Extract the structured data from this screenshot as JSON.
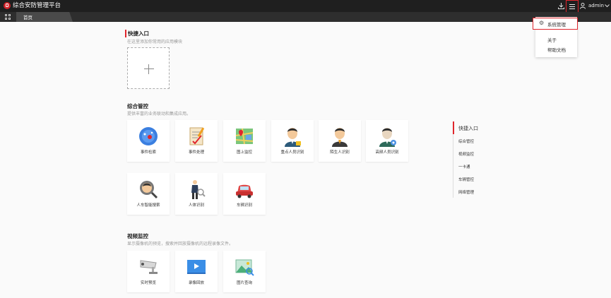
{
  "header": {
    "app_title": "综合安防管理平台",
    "username": "admin",
    "icons": [
      "download-icon",
      "menu-icon",
      "user-icon",
      "chevron-down-icon"
    ]
  },
  "tabs": [
    {
      "label": "首页",
      "active": true
    }
  ],
  "dropdown": {
    "system_management": "系统管理",
    "about": "关于",
    "help_docs": "帮助文档"
  },
  "quick_entry": {
    "title": "快捷入口",
    "desc": "在这里添加你常用的应用模块"
  },
  "integrated_control": {
    "title": "综合管控",
    "desc": "提供丰富的业务联动和集成应用。",
    "cards": [
      {
        "label": "事件检索",
        "icon": "event-search-icon"
      },
      {
        "label": "事件处理",
        "icon": "event-handling-icon"
      },
      {
        "label": "图上监控",
        "icon": "map-monitoring-icon"
      },
      {
        "label": "重点人员识别",
        "icon": "key-person-icon"
      },
      {
        "label": "陌生人识别",
        "icon": "stranger-icon"
      },
      {
        "label": "高频人员识别",
        "icon": "frequent-person-icon"
      },
      {
        "label": "人车智能搜索",
        "icon": "smart-search-icon"
      },
      {
        "label": "人体识别",
        "icon": "body-recognition-icon"
      },
      {
        "label": "车辆识别",
        "icon": "vehicle-recognition-icon"
      }
    ]
  },
  "video_monitoring": {
    "title": "视频监控",
    "desc": "显示摄像机的预览，搜索并回放摄像机的远程录像文件。",
    "cards": [
      {
        "label": "实时预览",
        "icon": "camera-icon"
      },
      {
        "label": "录像回放",
        "icon": "playback-icon"
      },
      {
        "label": "图片查询",
        "icon": "picture-icon"
      }
    ]
  },
  "anchor_nav": {
    "items": [
      "快捷入口",
      "综合管控",
      "视频监控",
      "一卡通",
      "车辆管控",
      "网络管理"
    ],
    "active_index": 0
  },
  "colors": {
    "accent": "#e0262d",
    "topbar": "#1f1f1f"
  }
}
